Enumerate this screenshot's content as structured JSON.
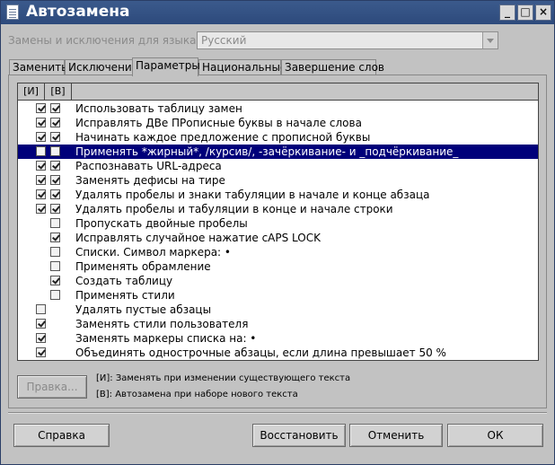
{
  "window": {
    "title": "Автозамена",
    "controls": [
      "_",
      "□",
      "×"
    ]
  },
  "language": {
    "label": "Замены и исключения для языка:",
    "value": "Русский"
  },
  "tabs": [
    {
      "label": "Заменить",
      "active": false
    },
    {
      "label": "Исключения",
      "active": false
    },
    {
      "label": "Параметры",
      "active": true
    },
    {
      "label": "Национальные",
      "active": false
    },
    {
      "label": "Завершение слов",
      "active": false
    }
  ],
  "list": {
    "columns": [
      "[И]",
      "[В]"
    ],
    "rows": [
      {
        "label": "Использовать таблицу замен",
        "m": true,
        "t": true
      },
      {
        "label": "Исправлять ДВе ПРописные буквы в начале слова",
        "m": true,
        "t": true
      },
      {
        "label": "Начинать каждое предложение с прописной буквы",
        "m": true,
        "t": true
      },
      {
        "label": "Применять *жирный*, /курсив/, -зачёркивание- и _подчёркивание_",
        "m": false,
        "t": false,
        "selected": true
      },
      {
        "label": "Распознавать URL-адреса",
        "m": true,
        "t": true
      },
      {
        "label": "Заменять дефисы на тире",
        "m": true,
        "t": true
      },
      {
        "label": "Удалять пробелы и знаки табуляции в начале и конце абзаца",
        "m": true,
        "t": true
      },
      {
        "label": "Удалять пробелы и табуляции в конце и начале строки",
        "m": true,
        "t": true
      },
      {
        "label": "Пропускать двойные пробелы",
        "m": null,
        "t": false
      },
      {
        "label": "Исправлять случайное нажатие cAPS LOCK",
        "m": null,
        "t": true
      },
      {
        "label": "Списки. Символ маркера: •",
        "m": null,
        "t": false
      },
      {
        "label": "Применять обрамление",
        "m": null,
        "t": false
      },
      {
        "label": "Создать таблицу",
        "m": null,
        "t": true
      },
      {
        "label": "Применять стили",
        "m": null,
        "t": false
      },
      {
        "label": "Удалять пустые абзацы",
        "m": false,
        "t": null
      },
      {
        "label": "Заменять стили пользователя",
        "m": true,
        "t": null
      },
      {
        "label": "Заменять маркеры списка на: •",
        "m": true,
        "t": null
      },
      {
        "label": "Объединять однострочные абзацы, если длина превышает 50  %",
        "m": true,
        "t": null
      }
    ]
  },
  "edit_button": "Правка...",
  "legend": {
    "m": "[И]: Заменять при изменении существующего текста",
    "t": "[В]: Автозамена при наборе нового текста"
  },
  "buttons": {
    "help": "Справка",
    "reset": "Восстановить",
    "cancel": "Отменить",
    "ok": "ОК"
  }
}
